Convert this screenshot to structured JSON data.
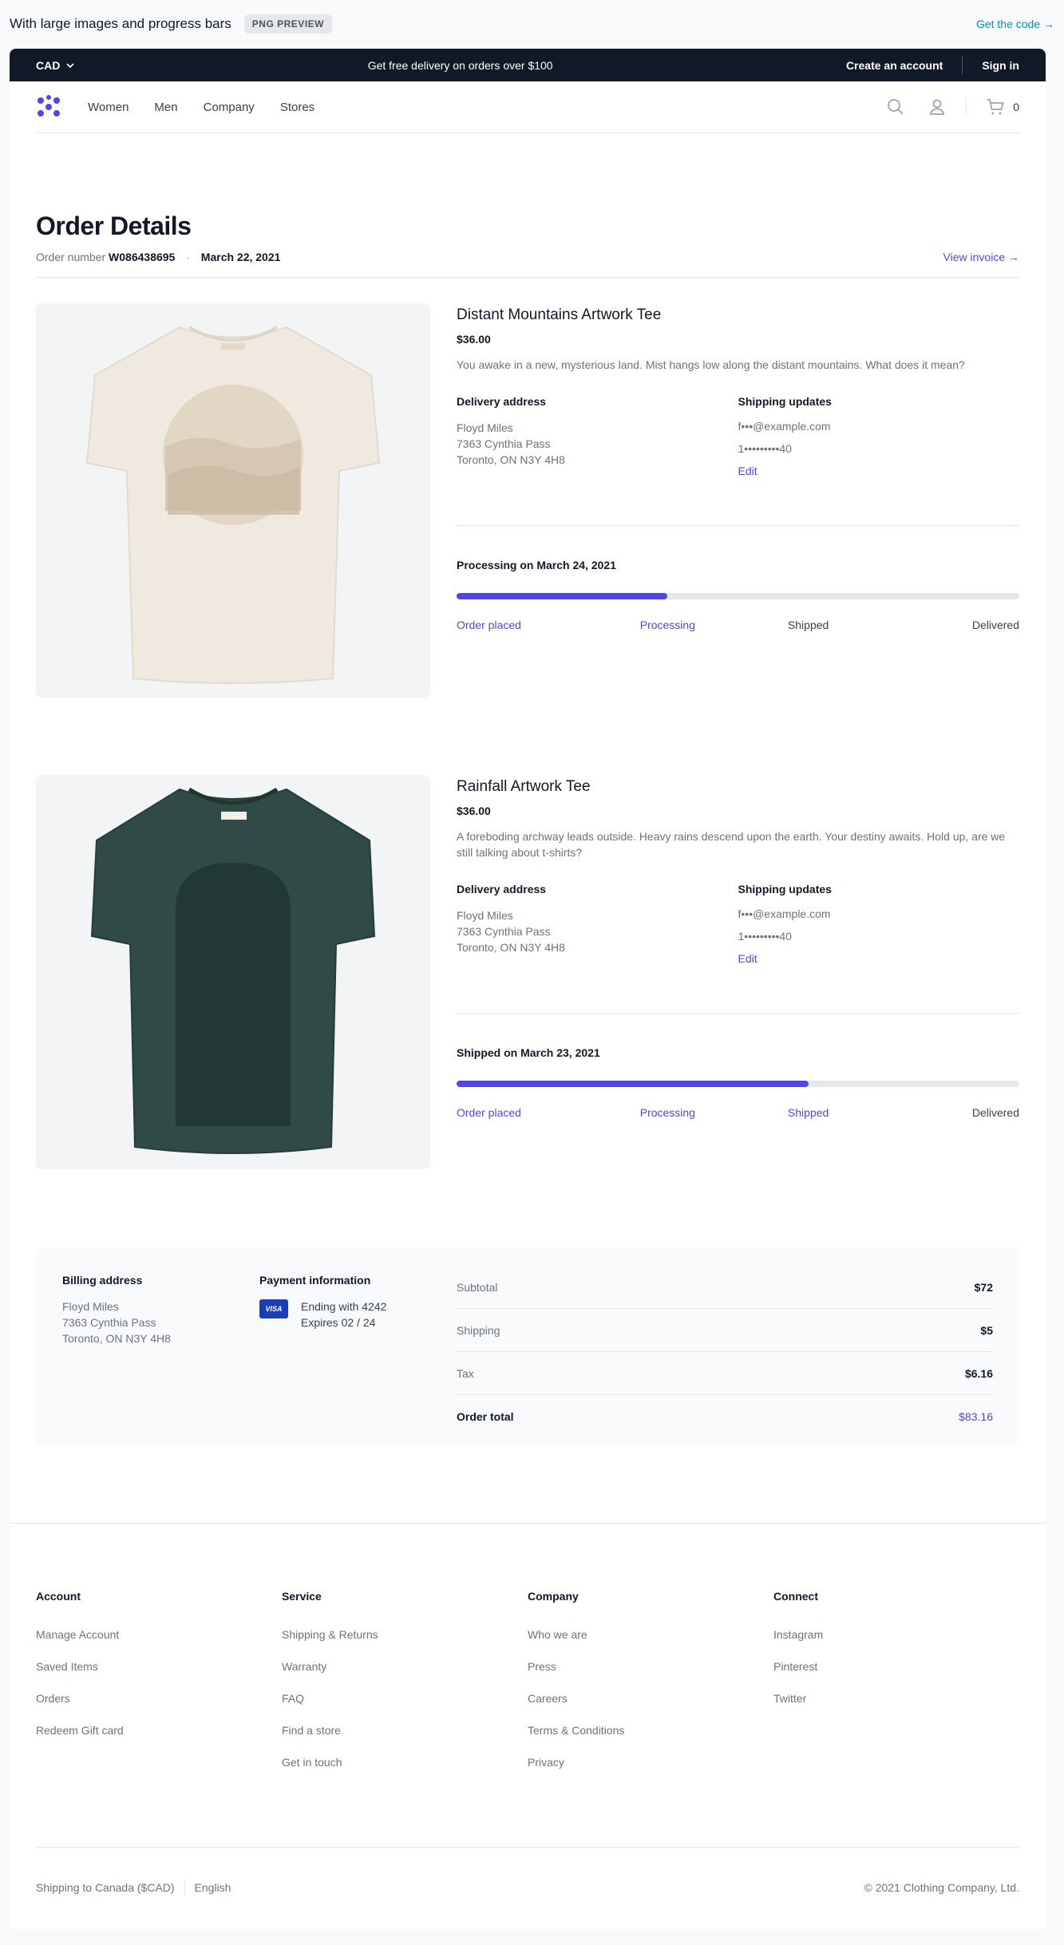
{
  "preview": {
    "title": "With large images and progress bars",
    "badge": "PNG PREVIEW",
    "code_link": "Get the code →"
  },
  "promo": {
    "currency": "CAD",
    "message": "Get free delivery on orders over $100",
    "create_account": "Create an account",
    "sign_in": "Sign in"
  },
  "nav": {
    "links": [
      "Women",
      "Men",
      "Company",
      "Stores"
    ],
    "cart_count": "0"
  },
  "order": {
    "title": "Order Details",
    "number_label": "Order number",
    "number": "W086438695",
    "date": "March 22, 2021",
    "invoice_link": "View invoice →"
  },
  "products": [
    {
      "name": "Distant Mountains Artwork Tee",
      "price": "$36.00",
      "description": "You awake in a new, mysterious land. Mist hangs low along the distant mountains. What does it mean?",
      "delivery_label": "Delivery address",
      "address": [
        "Floyd Miles",
        "7363 Cynthia Pass",
        "Toronto, ON N3Y 4H8"
      ],
      "shipping_label": "Shipping updates",
      "email": "f•••@example.com",
      "phone": "1•••••••••40",
      "edit": "Edit",
      "status": "Processing on March 24, 2021",
      "progress": 0.375,
      "steps": [
        "Order placed",
        "Processing",
        "Shipped",
        "Delivered"
      ],
      "steps_done": 2,
      "image_color": "#efe9df"
    },
    {
      "name": "Rainfall Artwork Tee",
      "price": "$36.00",
      "description": "A foreboding archway leads outside. Heavy rains descend upon the earth. Your destiny awaits. Hold up, are we still talking about t-shirts?",
      "delivery_label": "Delivery address",
      "address": [
        "Floyd Miles",
        "7363 Cynthia Pass",
        "Toronto, ON N3Y 4H8"
      ],
      "shipping_label": "Shipping updates",
      "email": "f•••@example.com",
      "phone": "1•••••••••40",
      "edit": "Edit",
      "status": "Shipped on March 23, 2021",
      "progress": 0.625,
      "steps": [
        "Order placed",
        "Processing",
        "Shipped",
        "Delivered"
      ],
      "steps_done": 3,
      "image_color": "#2f4a47"
    }
  ],
  "summary": {
    "billing_label": "Billing address",
    "billing": [
      "Floyd Miles",
      "7363 Cynthia Pass",
      "Toronto, ON N3Y 4H8"
    ],
    "payment_label": "Payment information",
    "card_brand": "VISA",
    "card_ending": "Ending with 4242",
    "card_expires": "Expires 02 / 24",
    "subtotal_label": "Subtotal",
    "subtotal": "$72",
    "shipping_label": "Shipping",
    "shipping": "$5",
    "tax_label": "Tax",
    "tax": "$6.16",
    "total_label": "Order total",
    "total": "$83.16"
  },
  "footer": {
    "columns": [
      {
        "title": "Account",
        "items": [
          "Manage Account",
          "Saved Items",
          "Orders",
          "Redeem Gift card"
        ]
      },
      {
        "title": "Service",
        "items": [
          "Shipping & Returns",
          "Warranty",
          "FAQ",
          "Find a store",
          "Get in touch"
        ]
      },
      {
        "title": "Company",
        "items": [
          "Who we are",
          "Press",
          "Careers",
          "Terms & Conditions",
          "Privacy"
        ]
      },
      {
        "title": "Connect",
        "items": [
          "Instagram",
          "Pinterest",
          "Twitter"
        ]
      }
    ],
    "shipping_to": "Shipping to Canada ($CAD)",
    "language": "English",
    "copyright": "© 2021 Clothing Company, Ltd."
  },
  "colors": {
    "accent": "#4f46e5",
    "dark": "#111827",
    "link": "#0891b2"
  }
}
